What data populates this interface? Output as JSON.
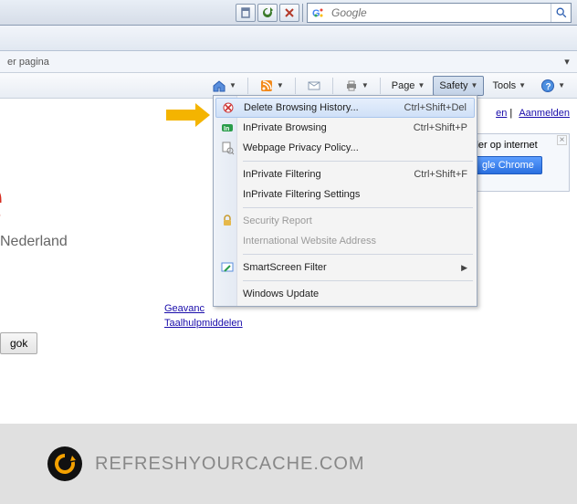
{
  "addressbar": {
    "search_placeholder": "Google",
    "search_provider": "Google"
  },
  "pagebar": {
    "text": "er pagina"
  },
  "commandbar": {
    "page": "Page",
    "safety": "Safety",
    "tools": "Tools"
  },
  "toplinks": {
    "gen": "en",
    "aanmelden": "Aanmelden"
  },
  "google": {
    "nederland": "Nederland",
    "link_geavanceerd": "Geavanc",
    "link_taalhulp": "Taalhulpmiddelen",
    "gok_button": "gok"
  },
  "promo": {
    "line1": "ller op internet",
    "chrome": "gle Chrome"
  },
  "safety_menu": {
    "items": [
      {
        "label": "Delete Browsing History...",
        "shortcut": "Ctrl+Shift+Del",
        "icon": "delete-history",
        "hl": true
      },
      {
        "label": "InPrivate Browsing",
        "shortcut": "Ctrl+Shift+P",
        "icon": "inprivate"
      },
      {
        "label": "Webpage Privacy Policy...",
        "shortcut": "",
        "icon": "privacy-policy"
      }
    ],
    "items2": [
      {
        "label": "InPrivate Filtering",
        "shortcut": "Ctrl+Shift+F"
      },
      {
        "label": "InPrivate Filtering Settings",
        "shortcut": ""
      }
    ],
    "items3": [
      {
        "label": "Security Report",
        "disabled": true,
        "icon": "lock"
      },
      {
        "label": "International Website Address",
        "disabled": true
      }
    ],
    "items4": [
      {
        "label": "SmartScreen Filter",
        "submenu": true,
        "icon": "smartscreen"
      }
    ],
    "items5": [
      {
        "label": "Windows Update"
      }
    ]
  },
  "footer": {
    "text": "REFRESHYOURCACHE.COM"
  }
}
